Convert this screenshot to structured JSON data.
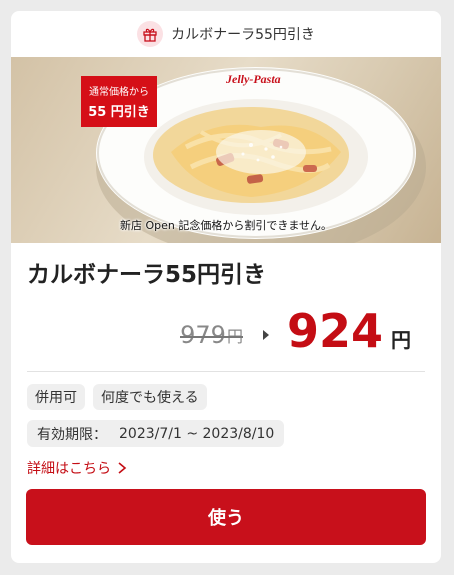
{
  "header": {
    "title": "カルボナーラ55円引き",
    "icon": "gift-icon"
  },
  "photo": {
    "plate_logo": "Jelly-Pasta",
    "promo_tag": {
      "line1": "通常価格から",
      "line2": "55 円引き"
    },
    "note": "新店 Open 記念価格から割引できません。"
  },
  "coupon": {
    "title": "カルボナーラ55円引き",
    "old_price": "979",
    "old_price_unit": "円",
    "new_price": "924",
    "new_price_unit": "円"
  },
  "chips": [
    "併用可",
    "何度でも使える"
  ],
  "validity": {
    "label": "有効期限：",
    "value": "2023/7/1 ~ 2023/8/10"
  },
  "details_link": "詳細はこちら",
  "use_button": "使う",
  "colors": {
    "accent": "#c8101b",
    "price_red": "#c40d14",
    "tag_red": "#d50f17",
    "page_bg": "#ebebeb"
  }
}
